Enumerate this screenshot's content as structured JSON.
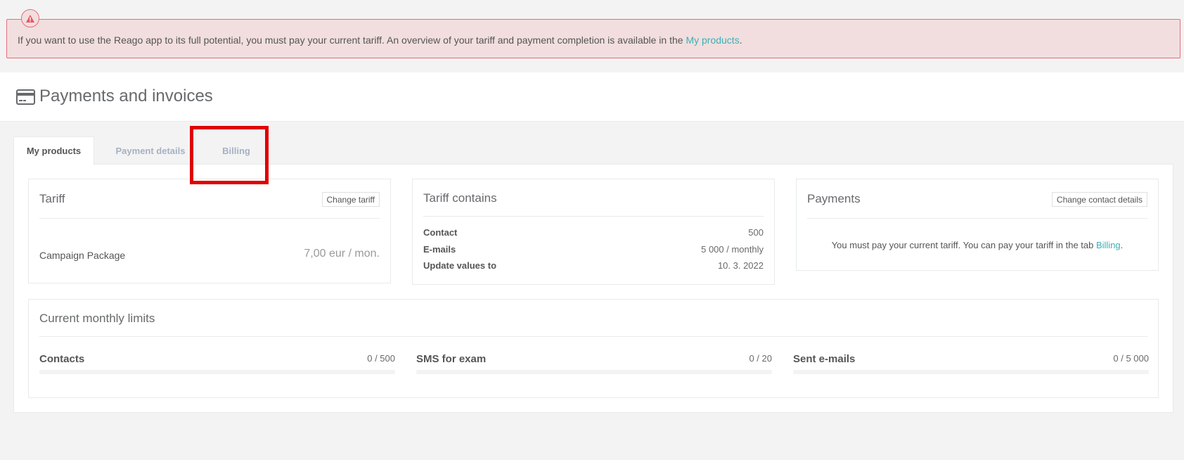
{
  "alert": {
    "icon": "warning-triangle-icon",
    "text_before": "If you want to use the Reago app to its full potential, you must pay your current tariff. An overview of your tariff and payment completion is available in the ",
    "link": "My products",
    "text_after": "."
  },
  "header": {
    "icon": "credit-card-icon",
    "title": "Payments and invoices"
  },
  "tabs": [
    {
      "label": "My products",
      "active": true
    },
    {
      "label": "Payment details",
      "active": false
    },
    {
      "label": "Billing",
      "active": false
    }
  ],
  "tariff": {
    "title": "Tariff",
    "change_button": "Change tariff",
    "package_name": "Campaign Package",
    "price": "7,00 eur / mon."
  },
  "tariff_contains": {
    "title": "Tariff contains",
    "rows": [
      {
        "label": "Contact",
        "value": "500"
      },
      {
        "label": "E-mails",
        "value": "5 000 / monthly"
      },
      {
        "label": "Update values to",
        "value": "10. 3. 2022"
      }
    ]
  },
  "payments": {
    "title": "Payments",
    "change_button": "Change contact details",
    "message_before": "You must pay your current tariff. You can pay your tariff in the tab ",
    "message_link": "Billing",
    "message_after": "."
  },
  "limits": {
    "title": "Current monthly limits",
    "items": [
      {
        "label": "Contacts",
        "value": "0 / 500",
        "fraction": 0
      },
      {
        "label": "SMS for exam",
        "value": "0 / 20",
        "fraction": 0
      },
      {
        "label": "Sent e-mails",
        "value": "0 / 5 000",
        "fraction": 0
      }
    ]
  },
  "colors": {
    "accent": "#3ab0b7",
    "alert_bg": "#f2dede",
    "alert_border": "#e0707a",
    "highlight": "#e00000"
  }
}
